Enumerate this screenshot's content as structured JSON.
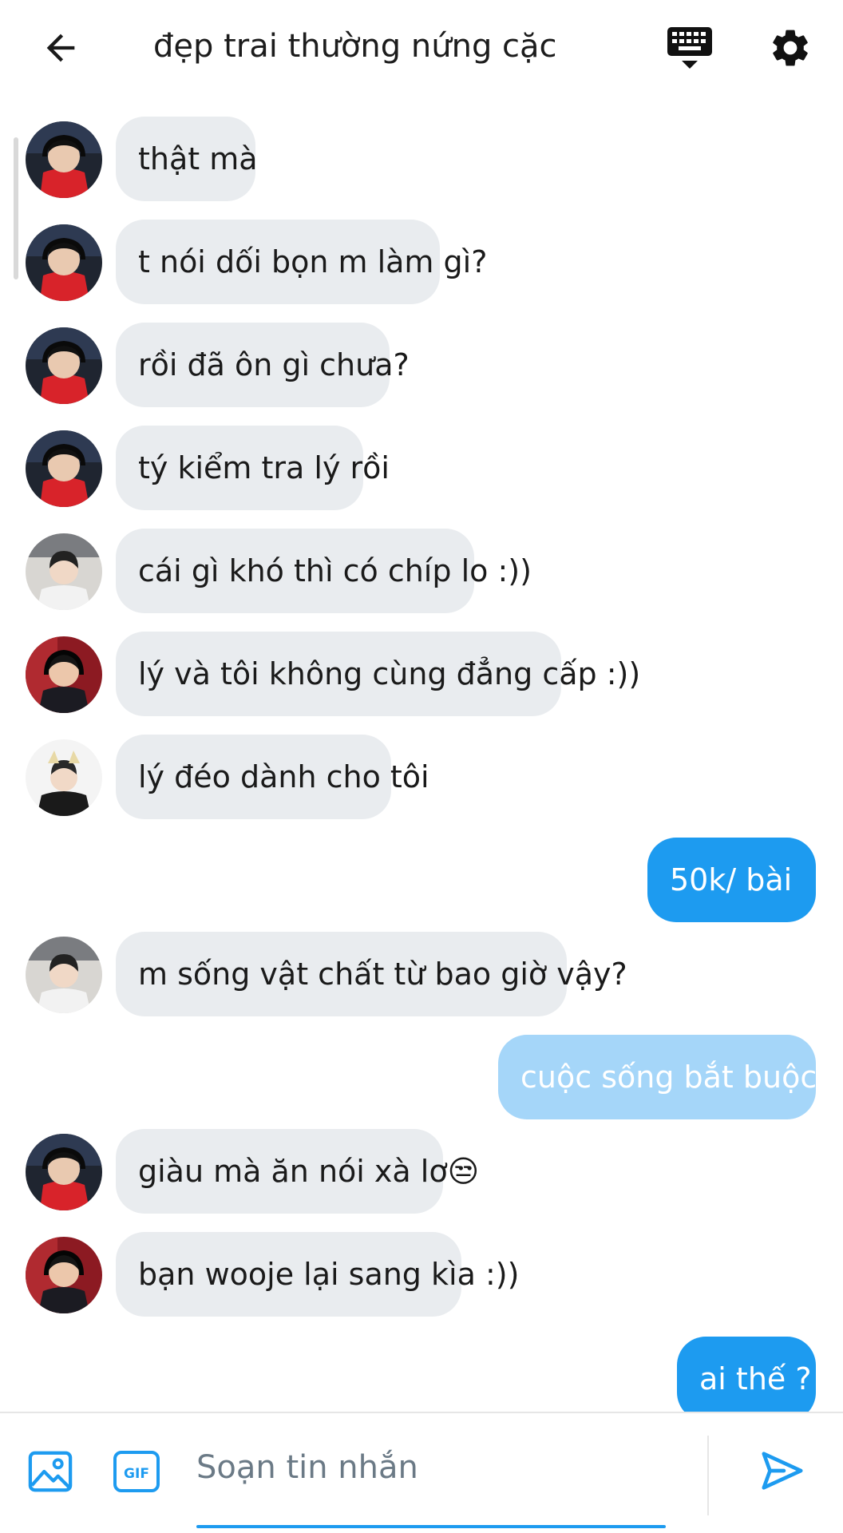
{
  "header": {
    "title": "đẹp trai thường nứng cặc",
    "back_icon": "arrow-left-icon",
    "keyboard_icon": "keyboard-icon",
    "settings_icon": "gear-icon"
  },
  "colors": {
    "outgoing_bubble": "#1d9bf0",
    "outgoing_pending_bubble": "#a5d6f9",
    "incoming_bubble": "#e9ecef",
    "accent": "#1d9bf0"
  },
  "messages": [
    {
      "direction": "incoming",
      "text": "thật mà"
    },
    {
      "direction": "incoming",
      "text": "t nói dối bọn m làm gì?"
    },
    {
      "direction": "incoming",
      "text": "rồi đã ôn gì chưa?"
    },
    {
      "direction": "incoming",
      "text": "tý kiểm tra lý rồi"
    },
    {
      "direction": "incoming",
      "text": "cái gì khó thì có chíp lo :))"
    },
    {
      "direction": "incoming",
      "text": "lý và tôi không cùng đẳng cấp :))"
    },
    {
      "direction": "incoming",
      "text": "lý đéo dành cho tôi"
    },
    {
      "direction": "outgoing",
      "text": "50k/ bài"
    },
    {
      "direction": "incoming",
      "text": "m sống vật chất từ bao giờ vậy?"
    },
    {
      "direction": "outgoing",
      "text": "cuộc sống bắt buộc :))",
      "status": "pending"
    },
    {
      "direction": "incoming",
      "text": "giàu mà ăn nói xà lơ😒"
    },
    {
      "direction": "incoming",
      "text": "bạn wooje lại sang kìa :))"
    },
    {
      "direction": "outgoing",
      "text": "ai thế ?"
    }
  ],
  "composer": {
    "placeholder": "Soạn tin nhắn",
    "value": "",
    "gif_label": "GIF",
    "image_icon": "image-icon",
    "send_icon": "send-icon"
  }
}
